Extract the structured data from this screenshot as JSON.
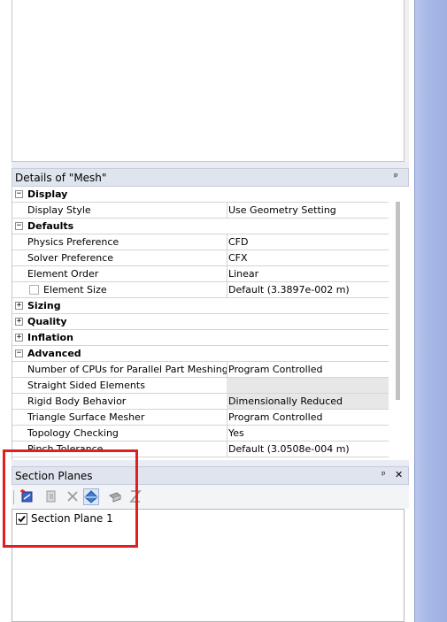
{
  "details_panel": {
    "title": "Details of \"Mesh\"",
    "pin": "ᵖ"
  },
  "details_rows": [
    {
      "type": "category",
      "label": "Display",
      "state": "−"
    },
    {
      "type": "property",
      "name": "Display Style",
      "value": "Use Geometry Setting"
    },
    {
      "type": "category",
      "label": "Defaults",
      "state": "−"
    },
    {
      "type": "property",
      "name": "Physics Preference",
      "value": "CFD"
    },
    {
      "type": "property",
      "name": "Solver Preference",
      "value": "CFX"
    },
    {
      "type": "property",
      "name": "Element Order",
      "value": "Linear"
    },
    {
      "type": "property",
      "name": "Element Size",
      "value": "Default (3.3897e-002 m)",
      "checkbox": true
    },
    {
      "type": "category",
      "label": "Sizing",
      "state": "+"
    },
    {
      "type": "category",
      "label": "Quality",
      "state": "+"
    },
    {
      "type": "category",
      "label": "Inflation",
      "state": "+"
    },
    {
      "type": "category",
      "label": "Advanced",
      "state": "−"
    },
    {
      "type": "property",
      "name": "Number of CPUs for Parallel Part Meshing",
      "value": "Program Controlled"
    },
    {
      "type": "property",
      "name": "Straight Sided Elements",
      "value": "",
      "value_gray": true
    },
    {
      "type": "property",
      "name": "Rigid Body Behavior",
      "value": "Dimensionally Reduced",
      "value_gray": true
    },
    {
      "type": "property",
      "name": "Triangle Surface Mesher",
      "value": "Program Controlled"
    },
    {
      "type": "property",
      "name": "Topology Checking",
      "value": "Yes"
    },
    {
      "type": "property",
      "name": "Pinch Tolerance",
      "value": "Default (3.0508e-004 m)"
    }
  ],
  "section_planes": {
    "title": "Section Planes",
    "pin": "ᵖ",
    "close": "✕",
    "items": [
      {
        "label": "Section Plane 1",
        "checked": true
      }
    ]
  },
  "colors": {
    "highlight_box": "#e02020",
    "header_bg": "#dfe4ee",
    "right_strip": "#a8b8e6"
  }
}
